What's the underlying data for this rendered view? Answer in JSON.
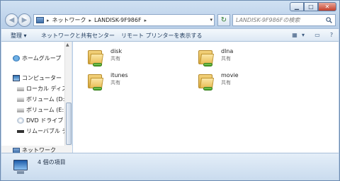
{
  "window": {
    "controls": {
      "minimize": "▁",
      "maximize": "□",
      "close": "✕"
    }
  },
  "address": {
    "crumbs": [
      "ネットワーク",
      "LANDISK-9F986F"
    ],
    "search_placeholder": "LANDISK-9F986Fの検索"
  },
  "toolbar": {
    "organize": "整理 ▾",
    "network_sharing": "ネットワークと共有センター",
    "remote_printers": "リモート プリンターを表示する"
  },
  "sidebar": {
    "homegroup": "ホームグループ",
    "computer": "コンピューター",
    "local_disk": "ローカル ディス",
    "volume_d": "ボリューム (D:)",
    "volume_e": "ボリューム (E:)",
    "dvd_drive": "DVD ドライブ (",
    "removable": "リムーバブル デ",
    "network": "ネットワーク"
  },
  "shares": [
    {
      "name": "disk",
      "type": "共有"
    },
    {
      "name": "dlna",
      "type": "共有"
    },
    {
      "name": "itunes",
      "type": "共有"
    },
    {
      "name": "movie",
      "type": "共有"
    }
  ],
  "status": {
    "item_count": "4 個の項目"
  }
}
